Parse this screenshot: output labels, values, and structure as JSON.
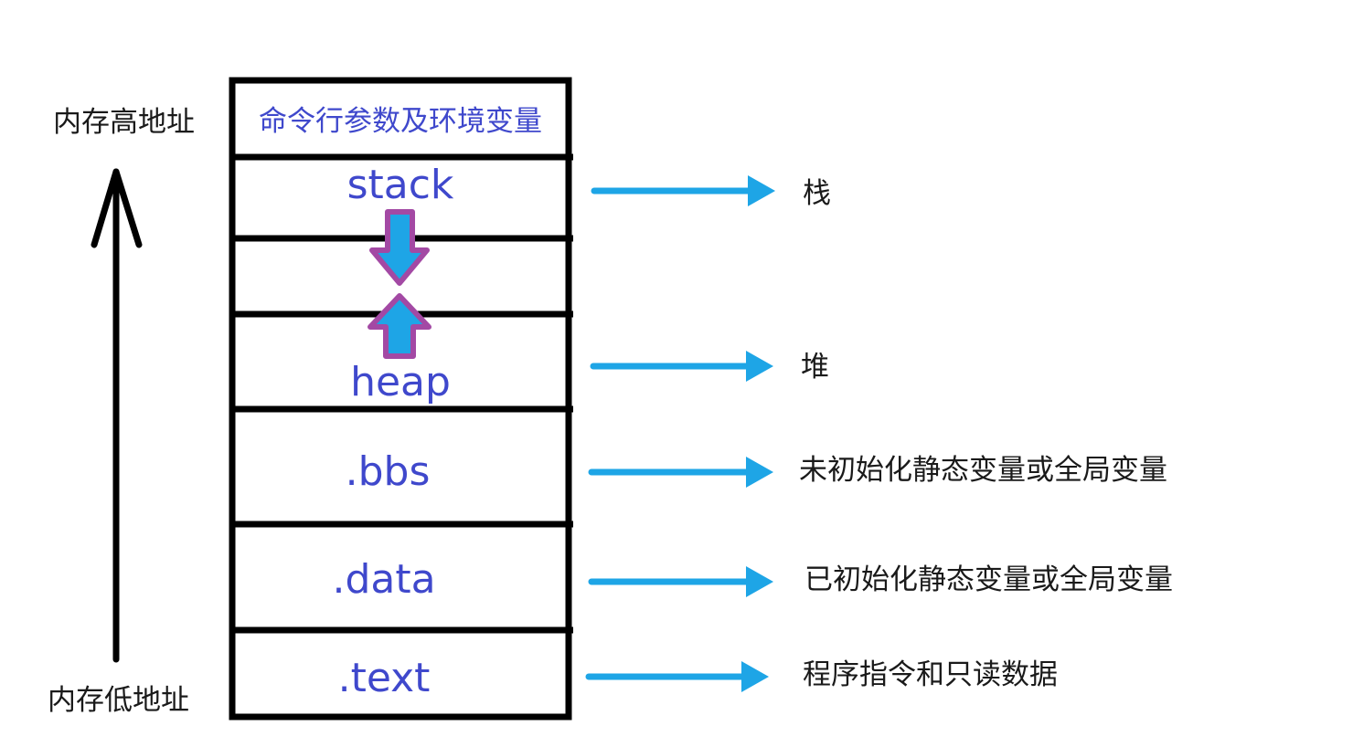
{
  "axis": {
    "high_label": "内存高地址",
    "low_label": "内存低地址",
    "direction": "up"
  },
  "segments": [
    {
      "id": "env",
      "label": "命令行参数及环境变量",
      "description": ""
    },
    {
      "id": "stack",
      "label": "stack",
      "description": "栈"
    },
    {
      "id": "gap",
      "label": "",
      "description": ""
    },
    {
      "id": "heap",
      "label": "heap",
      "description": "堆"
    },
    {
      "id": "bss",
      "label": ".bbs",
      "description": "未初始化静态变量或全局变量"
    },
    {
      "id": "data",
      "label": ".data",
      "description": "已初始化静态变量或全局变量"
    },
    {
      "id": "text",
      "label": ".text",
      "description": "程序指令和只读数据"
    }
  ],
  "growth_arrows": {
    "stack_direction": "down",
    "heap_direction": "up"
  },
  "colors": {
    "segment_text": "#3f48cc",
    "pointer_arrow": "#1ea5e6",
    "growth_arrow_fill": "#1ea5e6",
    "growth_arrow_outline": "#a349a4",
    "box_border": "#000000",
    "label_text": "#1a1a1a"
  }
}
